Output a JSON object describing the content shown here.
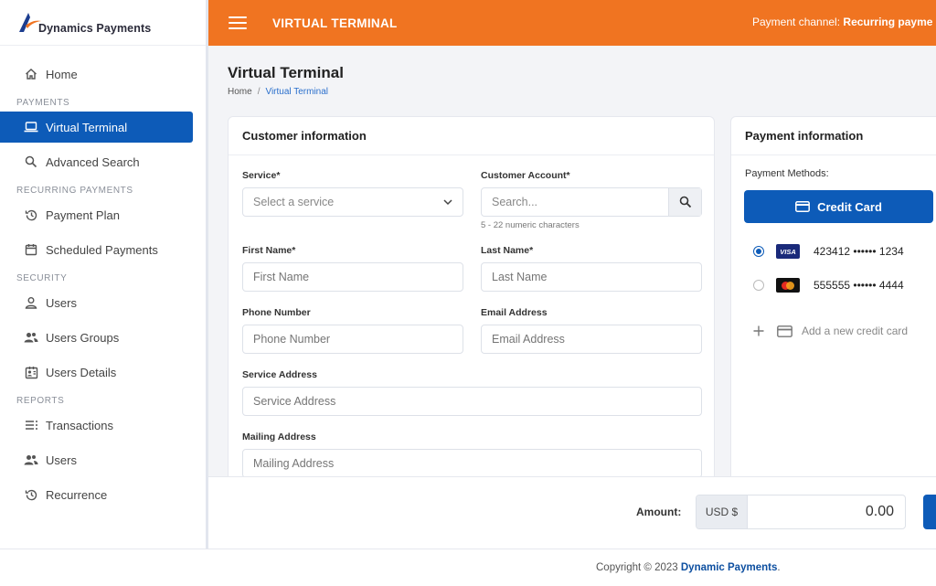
{
  "sidebar": {
    "logo_text": "Dynamics Payments",
    "home": "Home",
    "sections": {
      "payments": "PAYMENTS",
      "recurring": "RECURRING PAYMENTS",
      "security": "SECURITY",
      "reports": "REPORTS"
    },
    "items": {
      "virtual_terminal": "Virtual Terminal",
      "advanced_search": "Advanced Search",
      "payment_plan": "Payment Plan",
      "scheduled_payments": "Scheduled Payments",
      "users": "Users",
      "users_groups": "Users Groups",
      "users_details": "Users Details",
      "transactions": "Transactions",
      "report_users": "Users",
      "recurrence": "Recurrence"
    }
  },
  "header": {
    "title": "VIRTUAL TERMINAL",
    "channel_label": "Payment channel:",
    "channel_value": "Recurring payme"
  },
  "page": {
    "title": "Virtual Terminal",
    "breadcrumb_home": "Home",
    "breadcrumb_sep": "/",
    "breadcrumb_current": "Virtual Terminal"
  },
  "customer": {
    "title": "Customer information",
    "service_label": "Service*",
    "service_placeholder": "Select a service",
    "account_label": "Customer Account*",
    "account_placeholder": "Search...",
    "account_hint": "5 - 22 numeric characters",
    "first_name_label": "First Name*",
    "first_name_placeholder": "First Name",
    "last_name_label": "Last Name*",
    "last_name_placeholder": "Last Name",
    "phone_label": "Phone Number",
    "phone_placeholder": "Phone Number",
    "email_label": "Email Address",
    "email_placeholder": "Email Address",
    "service_address_label": "Service Address",
    "service_address_placeholder": "Service Address",
    "mailing_address_label": "Mailing Address",
    "mailing_address_placeholder": "Mailing Address"
  },
  "payment": {
    "title": "Payment information",
    "methods_label": "Payment Methods:",
    "credit_card_button": "Credit Card",
    "cards": [
      {
        "brand": "VISA",
        "number": "423412 •••••• 1234",
        "selected": true
      },
      {
        "brand": "mastercard",
        "number": "555555 •••••• 4444",
        "selected": false
      }
    ],
    "add_card": "Add a new credit card"
  },
  "amount": {
    "label": "Amount:",
    "currency": "USD $",
    "value": "0.00"
  },
  "footer": {
    "copyright": "Copyright © 2023",
    "company": "Dynamic Payments",
    "period": "."
  },
  "colors": {
    "header": "#f07421",
    "primary": "#0d5bb8",
    "background": "#f3f4f7"
  }
}
